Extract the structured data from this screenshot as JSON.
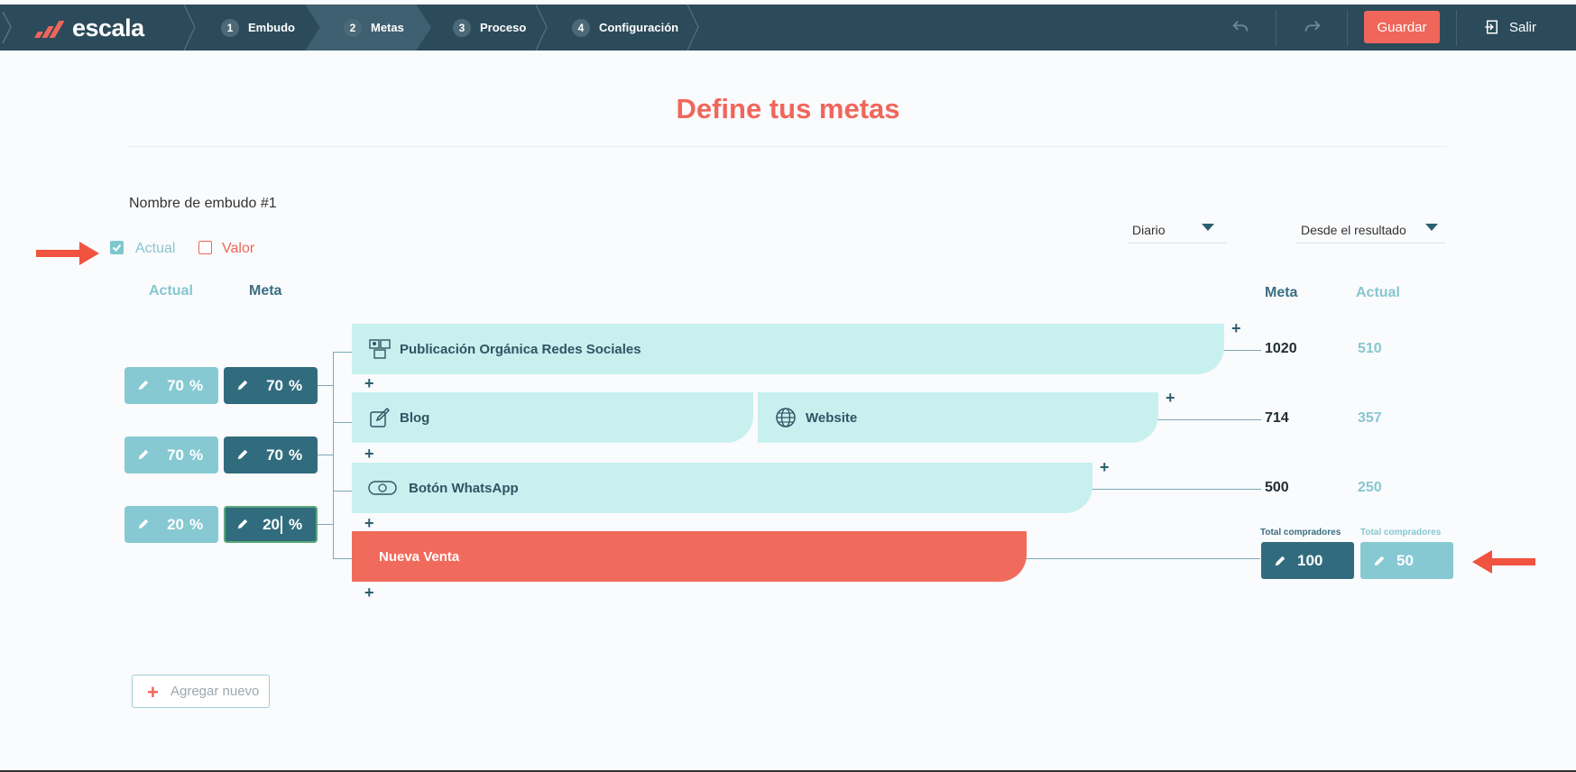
{
  "app": {
    "logo_text": "escala"
  },
  "nav": {
    "steps": [
      {
        "num": "1",
        "label": "Embudo"
      },
      {
        "num": "2",
        "label": "Metas"
      },
      {
        "num": "3",
        "label": "Proceso"
      },
      {
        "num": "4",
        "label": "Configuración"
      }
    ],
    "active_step": "Metas",
    "save_label": "Guardar",
    "exit_label": "Salir"
  },
  "page": {
    "title": "Define tus metas",
    "funnel_name": "Nombre de embudo #1"
  },
  "view_toggles": {
    "actual": {
      "label": "Actual",
      "checked": true
    },
    "valor": {
      "label": "Valor",
      "checked": false
    }
  },
  "filters": {
    "period": "Diario",
    "direction": "Desde el resultado"
  },
  "left_columns": {
    "actual": "Actual",
    "meta": "Meta"
  },
  "right_columns": {
    "meta": "Meta",
    "actual": "Actual"
  },
  "conversion_rates": [
    {
      "actual": "70",
      "meta": "70",
      "unit": "%"
    },
    {
      "actual": "70",
      "meta": "70",
      "unit": "%"
    },
    {
      "actual": "20",
      "meta": "20",
      "unit": "%"
    }
  ],
  "stages": [
    {
      "items": [
        {
          "label": "Publicación Orgánica Redes Sociales",
          "icon": "social-media-icon"
        }
      ],
      "meta": "1020",
      "actual": "510"
    },
    {
      "items": [
        {
          "label": "Blog",
          "icon": "blog-edit-icon"
        },
        {
          "label": "Website",
          "icon": "globe-icon"
        }
      ],
      "meta": "714",
      "actual": "357"
    },
    {
      "items": [
        {
          "label": "Botón WhatsApp",
          "icon": "whatsapp-button-icon"
        }
      ],
      "meta": "500",
      "actual": "250"
    },
    {
      "items": [
        {
          "label": "Nueva Venta"
        }
      ]
    }
  ],
  "totals": {
    "meta": {
      "label": "Total compradores",
      "value": "100"
    },
    "actual": {
      "label": "Total compradores",
      "value": "50"
    }
  },
  "add_new_label": "Agregar nuevo",
  "colors": {
    "topbar": "#2c4b5a",
    "accent": "#f0665a",
    "stage_bg": "#c8f0ef",
    "dark_teal": "#316c7e",
    "light_teal": "#86c9d2"
  }
}
